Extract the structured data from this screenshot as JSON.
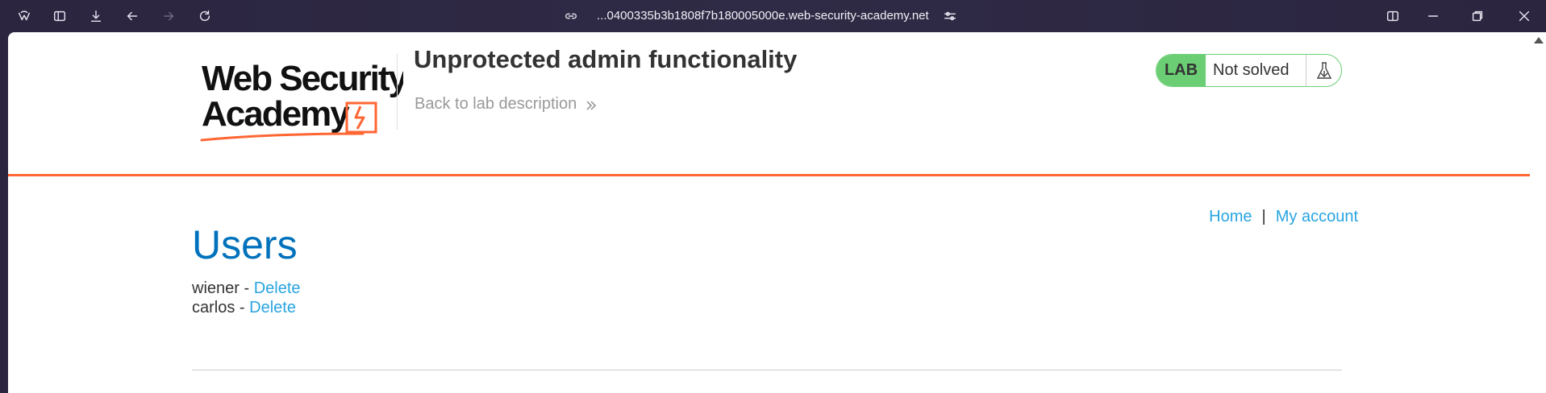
{
  "browser": {
    "url": "...0400335b3b1808f7b180005000e.web-security-academy.net",
    "icons": [
      "brand-icon",
      "sidebar-toggle-icon",
      "download-icon",
      "back-icon",
      "forward-icon",
      "reload-icon",
      "link-icon",
      "site-settings-icon",
      "split-view-icon",
      "minimize-icon",
      "restore-icon",
      "close-icon"
    ]
  },
  "logo": {
    "line1": "Web Security",
    "line2": "Academy"
  },
  "header": {
    "lab_title": "Unprotected admin functionality",
    "back_link": "Back to lab description",
    "status_tag": "LAB",
    "status_text": "Not solved"
  },
  "nav": {
    "home": "Home",
    "separator": "|",
    "account": "My account"
  },
  "main": {
    "title": "Users",
    "users": [
      {
        "name": "wiener",
        "sep": " - ",
        "action": "Delete"
      },
      {
        "name": "carlos",
        "sep": " - ",
        "action": "Delete"
      }
    ]
  },
  "colors": {
    "accent_orange": "#ff6633",
    "link_blue": "#29a4e0",
    "title_blue": "#0071bc",
    "status_green": "#6bce74"
  }
}
